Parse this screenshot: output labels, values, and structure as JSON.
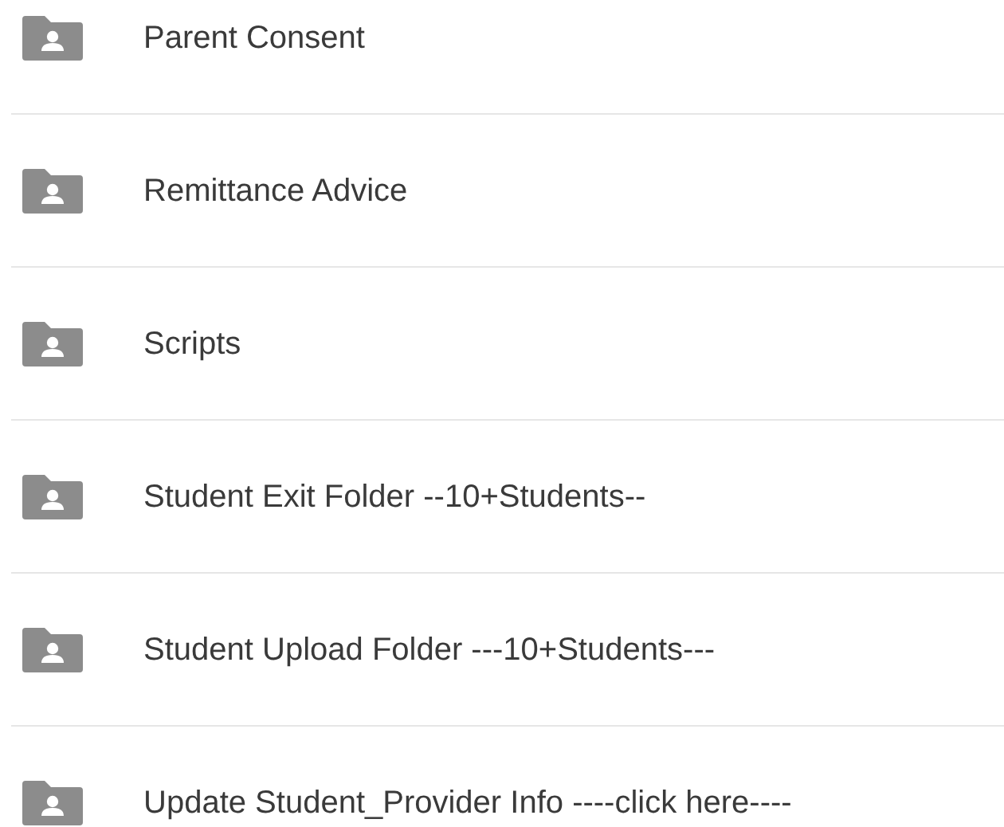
{
  "folders": [
    {
      "name": "Parent Consent"
    },
    {
      "name": "Remittance Advice"
    },
    {
      "name": "Scripts"
    },
    {
      "name": "Student Exit Folder --10+Students--"
    },
    {
      "name": "Student Upload Folder ---10+Students---"
    },
    {
      "name": "Update Student_Provider Info ----click here----"
    }
  ]
}
